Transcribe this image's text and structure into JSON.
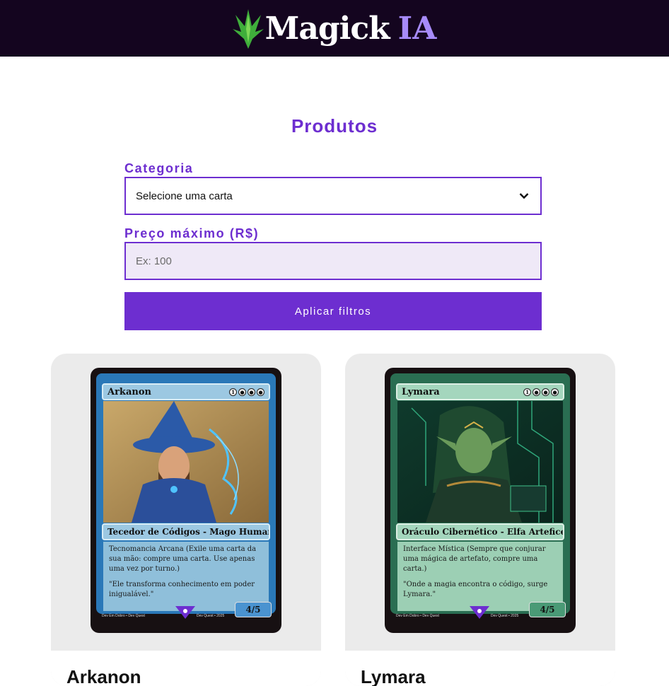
{
  "brand": {
    "name": "Magick",
    "accent": "IA",
    "accent_color": "#a78bfa",
    "bg_color": "#14051f"
  },
  "page": {
    "title": "Produtos",
    "accent_color": "#6d2ed0"
  },
  "filters": {
    "category_label": "Categoria",
    "category_value": "Selecione uma carta",
    "max_price_label": "Preço máximo (R$)",
    "max_price_placeholder": "Ex: 100",
    "apply_label": "Aplicar filtros"
  },
  "products": [
    {
      "name": "Arkanon",
      "card": {
        "title": "Arkanon",
        "type": "Tecedor de Códigos - Mago Humano",
        "ability": "Tecnomancia Arcana (Exile uma carta da sua mão: compre uma carta. Use apenas uma vez por turno.)",
        "flavor": "\"Ele transforma conhecimento em poder inigualável.\"",
        "pt": "4/5",
        "credit_left": "Dev Em Dobro • Dev Quest",
        "credit_right": "Dev Quest • 2025",
        "color": "blue"
      }
    },
    {
      "name": "Lymara",
      "card": {
        "title": "Lymara",
        "type": "Oráculo Cibernético - Elfa Artefice",
        "ability": "Interface Mística (Sempre que conjurar uma mágica de artefato, compre uma carta.)",
        "flavor": "\"Onde a magia encontra o código, surge Lymara.\"",
        "pt": "4/5",
        "credit_left": "Dev Em Dobro • Dev Quest",
        "credit_right": "Dev Quest • 2025",
        "color": "green"
      }
    }
  ]
}
